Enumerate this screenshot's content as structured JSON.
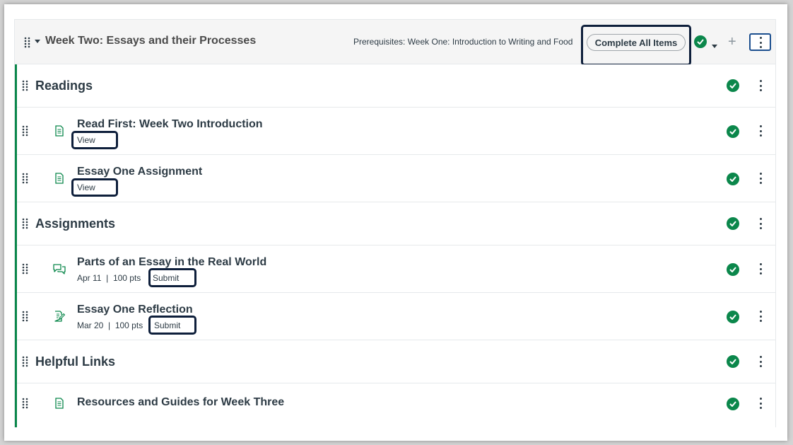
{
  "module": {
    "title": "Week Two: Essays and their Processes",
    "prerequisites": "Prerequisites: Week One: Introduction to Writing and Food",
    "complete_button": "Complete All Items"
  },
  "readings": {
    "title": "Readings",
    "items": [
      {
        "title": "Read First: Week Two Introduction",
        "action": "View",
        "icon": "page-icon"
      },
      {
        "title": "Essay One Assignment",
        "action": "View",
        "icon": "page-icon"
      }
    ]
  },
  "assignments": {
    "title": "Assignments",
    "items": [
      {
        "title": "Parts of an Essay in the Real World",
        "date": "Apr 11",
        "sep": "|",
        "points": "100 pts",
        "action": "Submit",
        "icon": "discussion-icon"
      },
      {
        "title": "Essay One Reflection",
        "date": "Mar 20",
        "sep": "|",
        "points": "100 pts",
        "action": "Submit",
        "icon": "assignment-icon"
      }
    ]
  },
  "links": {
    "title": "Helpful Links",
    "items": [
      {
        "title": "Resources and Guides for Week Three",
        "icon": "page-icon"
      }
    ]
  },
  "colors": {
    "complete_green": "#0b874b",
    "highlight_navy": "#0e1f3b",
    "text": "#2d3b45"
  }
}
